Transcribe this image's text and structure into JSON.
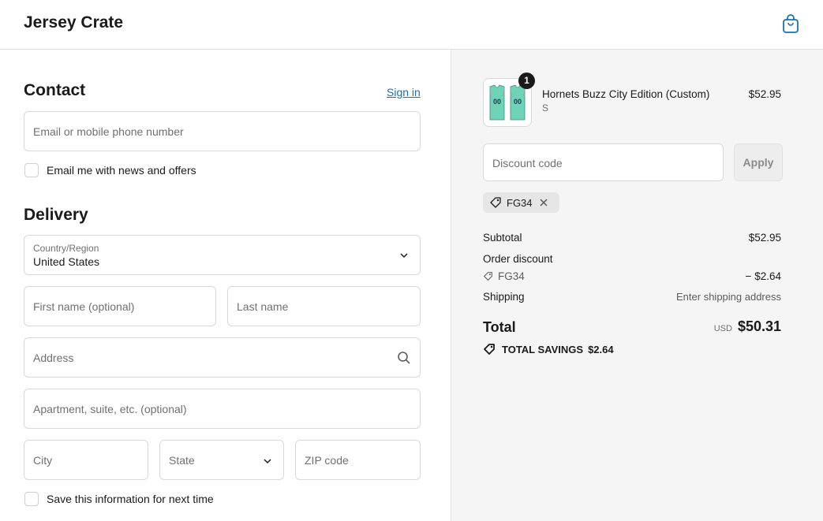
{
  "header": {
    "brand": "Jersey Crate",
    "cart_icon": "shopping-bag-icon"
  },
  "contact": {
    "title": "Contact",
    "sign_in": "Sign in",
    "email_placeholder": "Email or mobile phone number",
    "news_offers_label": "Email me with news and offers"
  },
  "delivery": {
    "title": "Delivery",
    "country_label": "Country/Region",
    "country_value": "United States",
    "first_name_placeholder": "First name (optional)",
    "last_name_placeholder": "Last name",
    "address_placeholder": "Address",
    "apartment_placeholder": "Apartment, suite, etc. (optional)",
    "city_placeholder": "City",
    "state_placeholder": "State",
    "zip_placeholder": "ZIP code",
    "save_info_label": "Save this information for next time"
  },
  "summary": {
    "product": {
      "quantity": "1",
      "name": "Hornets Buzz City Edition (Custom)",
      "variant": "S",
      "price": "$52.95",
      "jersey_color": "#6fd3b8",
      "jersey_number": "00"
    },
    "discount_placeholder": "Discount code",
    "apply_label": "Apply",
    "applied_code": "FG34",
    "subtotal_label": "Subtotal",
    "subtotal_value": "$52.95",
    "order_discount_label": "Order discount",
    "order_discount_code": "FG34",
    "order_discount_value": "− $2.64",
    "shipping_label": "Shipping",
    "shipping_value": "Enter shipping address",
    "total_label": "Total",
    "currency": "USD",
    "total_value": "$50.31",
    "savings_label": "TOTAL SAVINGS",
    "savings_value": "$2.64"
  },
  "colors": {
    "link": "#1773b0",
    "panel_bg": "#f5f5f5",
    "border": "#d9d9d9"
  }
}
